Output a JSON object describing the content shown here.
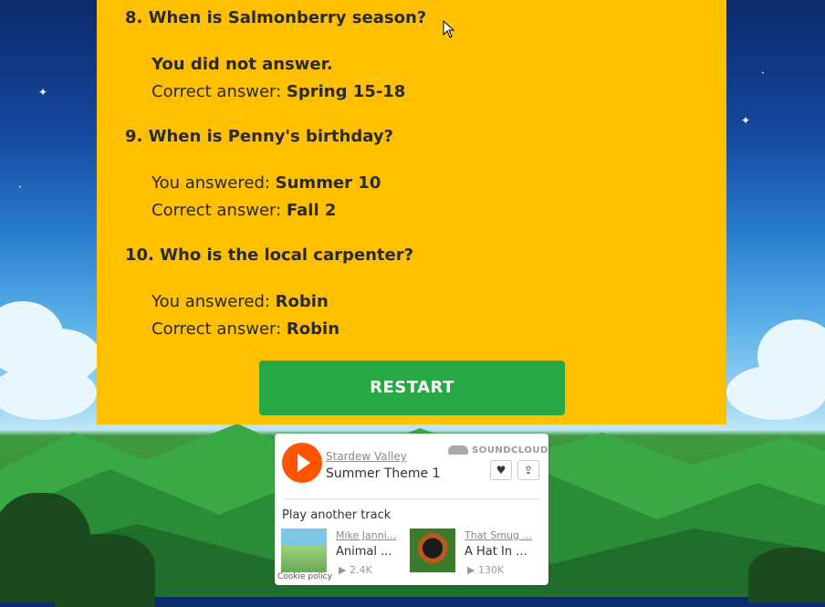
{
  "quiz": {
    "questions": [
      {
        "title": "8. When is Salmonberry season?",
        "first_line": "You did not answer.",
        "correct_label": "Correct answer: ",
        "correct_value": "Spring 15-18"
      },
      {
        "title": "9. When is Penny's birthday?",
        "answered_label": "You answered: ",
        "answered_value": "Summer 10",
        "correct_label": "Correct answer: ",
        "correct_value": "Fall 2"
      },
      {
        "title": "10. Who is the local carpenter?",
        "answered_label": "You answered: ",
        "answered_value": "Robin",
        "correct_label": "Correct answer: ",
        "correct_value": "Robin"
      }
    ],
    "restart_label": "RESTART",
    "panel_color": "#ffc000",
    "restart_color": "#28a745"
  },
  "soundcloud": {
    "artist": "Stardew Valley",
    "track_title": "Summer Theme 1",
    "brand": "SOUNDCLOUD",
    "like_icon": "heart-icon",
    "share_icon": "share-icon",
    "another_label": "Play another track",
    "tracks": [
      {
        "artist": "Mike Janni...",
        "title": "Animal ...",
        "plays": "2.4K"
      },
      {
        "artist": "That Smug ...",
        "title": "A Hat In ...",
        "plays": "130K"
      }
    ],
    "cookie_policy": "Cookie policy",
    "accent_color": "#ff5500"
  }
}
